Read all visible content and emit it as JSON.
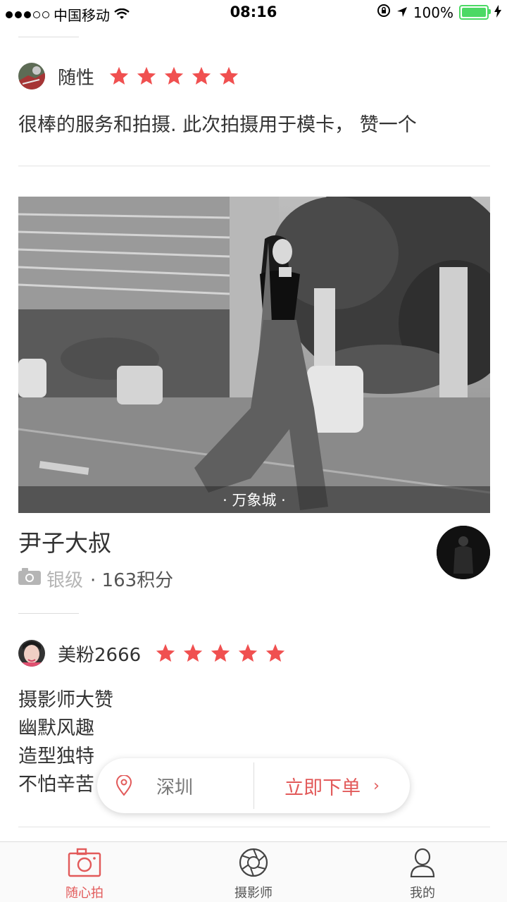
{
  "status_bar": {
    "carrier": "中国移动",
    "time": "08:16",
    "battery_percent": "100%",
    "battery_level": 1.0
  },
  "reviews": [
    {
      "username": "随性",
      "rating": 5,
      "text_lines": [
        "很棒的服务和拍摄. 此次拍摄用于模卡，  赞一个"
      ]
    },
    {
      "username": "美粉2666",
      "rating": 5,
      "text_lines": [
        "摄影师大赞",
        "幽默风趣",
        "造型独特",
        "不怕辛苦"
      ]
    }
  ],
  "photo": {
    "location_caption": "·  万象城  ·"
  },
  "photographer": {
    "name": "尹子大叔",
    "level_label": "银级",
    "points": "· 163积分"
  },
  "order_bar": {
    "city": "深圳",
    "order_label": "立即下单",
    "chevron": "›"
  },
  "tabs": [
    {
      "label": "随心拍",
      "icon": "camera-icon",
      "active": true
    },
    {
      "label": "摄影师",
      "icon": "aperture-icon",
      "active": false
    },
    {
      "label": "我的",
      "icon": "person-icon",
      "active": false
    }
  ],
  "colors": {
    "accent": "#e25a5a",
    "star": "#f05050",
    "battery": "#4cd964"
  }
}
